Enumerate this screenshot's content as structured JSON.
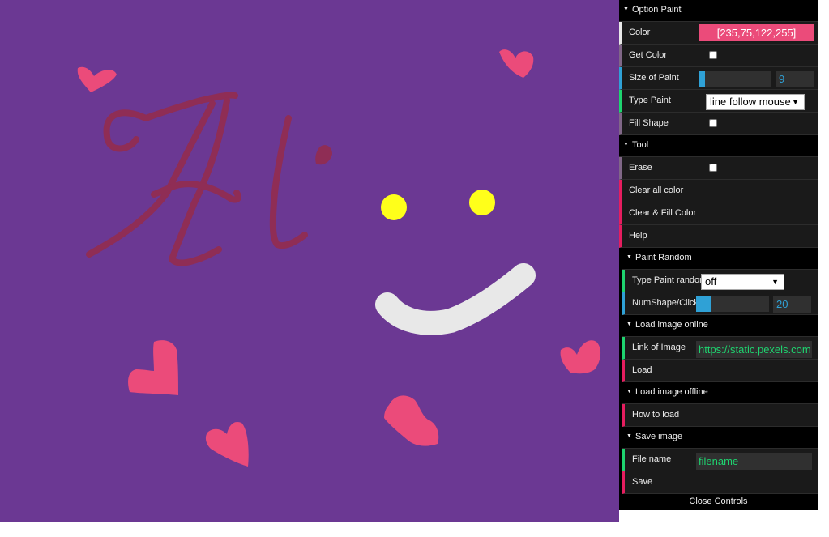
{
  "canvas": {
    "background": "#6b3893",
    "text_drawn": "Hi",
    "accent_colors": {
      "hearts": "#eb4b7a",
      "text": "#8f2d55",
      "eyes": "#ffff1a",
      "smile": "#e8e8e8"
    }
  },
  "gui": {
    "option_paint": {
      "title": "Option Paint",
      "color_label": "Color",
      "color_value": "[235,75,122,255]",
      "get_color_label": "Get Color",
      "size_label": "Size of Paint",
      "size_value": "9",
      "size_fraction": 0.09,
      "type_label": "Type Paint",
      "type_value": "line follow mouse",
      "fill_label": "Fill Shape"
    },
    "tool": {
      "title": "Tool",
      "erase_label": "Erase",
      "clear_all_label": "Clear all color",
      "clear_fill_label": "Clear & Fill Color",
      "help_label": "Help"
    },
    "paint_random": {
      "title": "Paint Random",
      "type_label": "Type Paint random",
      "type_value": "off",
      "num_label": "NumShape/Click",
      "num_value": "20",
      "num_fraction": 0.2
    },
    "load_online": {
      "title": "Load image online",
      "link_label": "Link of Image",
      "link_value": "https://static.pexels.com",
      "load_label": "Load"
    },
    "load_offline": {
      "title": "Load image offline",
      "how_label": "How to load"
    },
    "save_image": {
      "title": "Save image",
      "filename_label": "File name",
      "filename_value": "filename",
      "save_label": "Save"
    },
    "close_label": "Close Controls"
  }
}
